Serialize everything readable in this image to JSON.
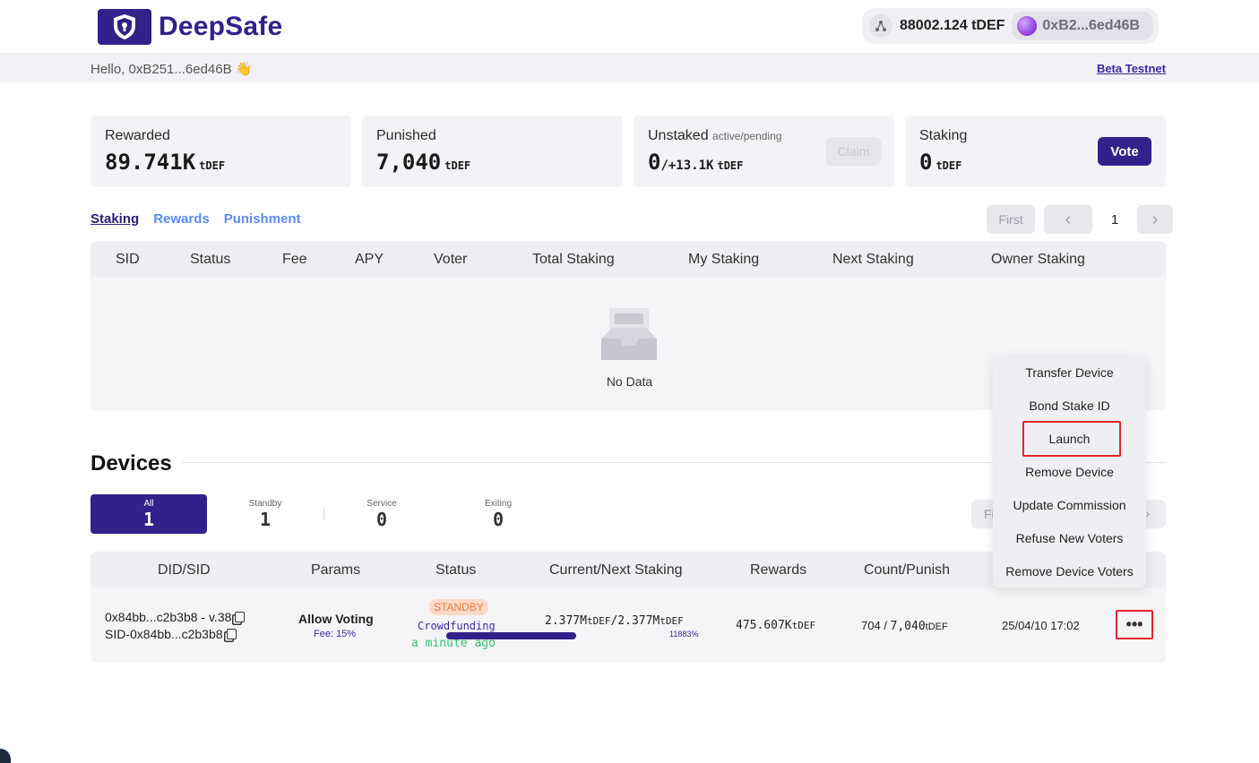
{
  "brand": {
    "name": "DeepSafe"
  },
  "wallet": {
    "balance": "88002.124 tDEF",
    "address": "0xB2...6ed46B"
  },
  "greeting": {
    "text": "Hello, 0xB251...6ed46B 👋",
    "network_link": "Beta Testnet"
  },
  "stats": {
    "rewarded": {
      "label": "Rewarded",
      "value": "89.741K",
      "unit": "tDEF"
    },
    "punished": {
      "label": "Punished",
      "value": "7,040",
      "unit": "tDEF"
    },
    "unstaked": {
      "label": "Unstaked",
      "sublabel": "active/pending",
      "value": "0",
      "pending": "/+13.1K",
      "unit": "tDEF",
      "button": "Claim"
    },
    "staking": {
      "label": "Staking",
      "value": "0",
      "unit": "tDEF",
      "button": "Vote"
    }
  },
  "tabs": [
    "Staking",
    "Rewards",
    "Punishment"
  ],
  "pager": {
    "first": "First",
    "prev": "‹",
    "page": "1",
    "next": "›"
  },
  "staking_table": {
    "columns": [
      "SID",
      "Status",
      "Fee",
      "APY",
      "Voter",
      "Total Staking",
      "My Staking",
      "Next Staking",
      "Owner Staking"
    ],
    "empty_text": "No Data"
  },
  "devices": {
    "title": "Devices",
    "filters": [
      {
        "label": "All",
        "count": "1"
      },
      {
        "label": "Standby",
        "count": "1"
      },
      {
        "label": "Service",
        "count": "0"
      },
      {
        "label": "Exiting",
        "count": "0"
      }
    ],
    "pager_first": "Fi",
    "pager_next": "›",
    "columns": [
      "DID/SID",
      "Params",
      "Status",
      "Current/Next Staking",
      "Rewards",
      "Count/Punish"
    ],
    "row": {
      "did": "0x84bb...c2b3b8 - v.38",
      "sid": "SID-0x84bb...c2b3b8",
      "params": "Allow Voting",
      "fee": "Fee: 15%",
      "status_badge": "STANDBY",
      "status_text": "Crowdfunding",
      "status_time": "a minute ago",
      "staking_current": "2.377M",
      "staking_unit": "tDEF",
      "staking_next": "2.377M",
      "staking_unit2": "tDEF",
      "staking_percent": "11883%",
      "staking_progress": 1.0,
      "rewards": "475.607K",
      "rewards_unit": "tDEF",
      "count": "704 / ",
      "punish": "7,040",
      "punish_unit": "tDEF",
      "date": "25/04/10 17:02",
      "more": "•••"
    }
  },
  "menu": {
    "items": [
      "Transfer Device",
      "Bond Stake ID",
      "Launch",
      "Remove Device",
      "Update Commission",
      "Refuse New Voters",
      "Remove Device Voters"
    ],
    "highlighted": "Launch"
  },
  "colors": {
    "brand": "#34208a",
    "tab_link": "#5c8cf0",
    "highlight": "#e0242a",
    "standby": "#ef7a3f"
  }
}
